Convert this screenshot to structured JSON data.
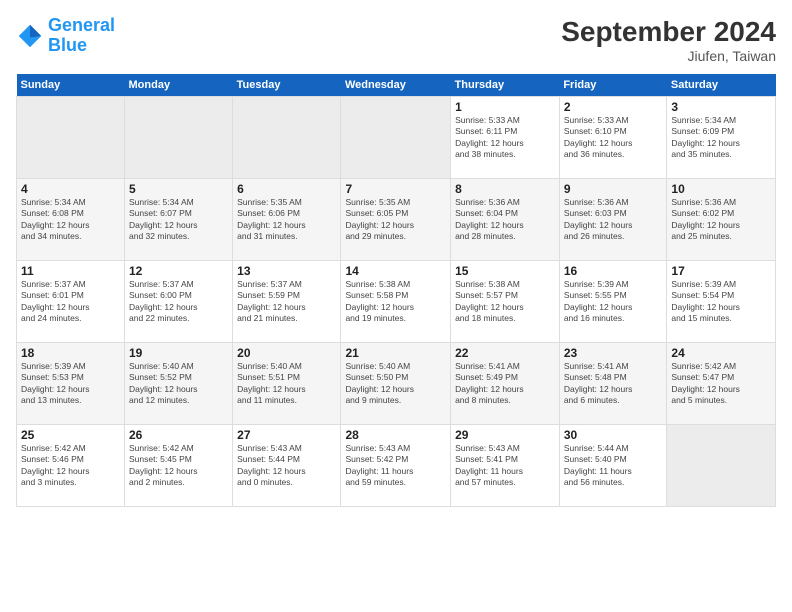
{
  "header": {
    "logo_line1": "General",
    "logo_line2": "Blue",
    "month": "September 2024",
    "location": "Jiufen, Taiwan"
  },
  "weekdays": [
    "Sunday",
    "Monday",
    "Tuesday",
    "Wednesday",
    "Thursday",
    "Friday",
    "Saturday"
  ],
  "days": [
    {
      "num": "",
      "info": "",
      "empty": true
    },
    {
      "num": "",
      "info": "",
      "empty": true
    },
    {
      "num": "",
      "info": "",
      "empty": true
    },
    {
      "num": "",
      "info": "",
      "empty": true
    },
    {
      "num": "1",
      "info": "Sunrise: 5:33 AM\nSunset: 6:11 PM\nDaylight: 12 hours\nand 38 minutes."
    },
    {
      "num": "2",
      "info": "Sunrise: 5:33 AM\nSunset: 6:10 PM\nDaylight: 12 hours\nand 36 minutes."
    },
    {
      "num": "3",
      "info": "Sunrise: 5:34 AM\nSunset: 6:09 PM\nDaylight: 12 hours\nand 35 minutes."
    },
    {
      "num": "4",
      "info": "Sunrise: 5:34 AM\nSunset: 6:08 PM\nDaylight: 12 hours\nand 34 minutes."
    },
    {
      "num": "5",
      "info": "Sunrise: 5:34 AM\nSunset: 6:07 PM\nDaylight: 12 hours\nand 32 minutes."
    },
    {
      "num": "6",
      "info": "Sunrise: 5:35 AM\nSunset: 6:06 PM\nDaylight: 12 hours\nand 31 minutes."
    },
    {
      "num": "7",
      "info": "Sunrise: 5:35 AM\nSunset: 6:05 PM\nDaylight: 12 hours\nand 29 minutes."
    },
    {
      "num": "8",
      "info": "Sunrise: 5:36 AM\nSunset: 6:04 PM\nDaylight: 12 hours\nand 28 minutes."
    },
    {
      "num": "9",
      "info": "Sunrise: 5:36 AM\nSunset: 6:03 PM\nDaylight: 12 hours\nand 26 minutes."
    },
    {
      "num": "10",
      "info": "Sunrise: 5:36 AM\nSunset: 6:02 PM\nDaylight: 12 hours\nand 25 minutes."
    },
    {
      "num": "11",
      "info": "Sunrise: 5:37 AM\nSunset: 6:01 PM\nDaylight: 12 hours\nand 24 minutes."
    },
    {
      "num": "12",
      "info": "Sunrise: 5:37 AM\nSunset: 6:00 PM\nDaylight: 12 hours\nand 22 minutes."
    },
    {
      "num": "13",
      "info": "Sunrise: 5:37 AM\nSunset: 5:59 PM\nDaylight: 12 hours\nand 21 minutes."
    },
    {
      "num": "14",
      "info": "Sunrise: 5:38 AM\nSunset: 5:58 PM\nDaylight: 12 hours\nand 19 minutes."
    },
    {
      "num": "15",
      "info": "Sunrise: 5:38 AM\nSunset: 5:57 PM\nDaylight: 12 hours\nand 18 minutes."
    },
    {
      "num": "16",
      "info": "Sunrise: 5:39 AM\nSunset: 5:55 PM\nDaylight: 12 hours\nand 16 minutes."
    },
    {
      "num": "17",
      "info": "Sunrise: 5:39 AM\nSunset: 5:54 PM\nDaylight: 12 hours\nand 15 minutes."
    },
    {
      "num": "18",
      "info": "Sunrise: 5:39 AM\nSunset: 5:53 PM\nDaylight: 12 hours\nand 13 minutes."
    },
    {
      "num": "19",
      "info": "Sunrise: 5:40 AM\nSunset: 5:52 PM\nDaylight: 12 hours\nand 12 minutes."
    },
    {
      "num": "20",
      "info": "Sunrise: 5:40 AM\nSunset: 5:51 PM\nDaylight: 12 hours\nand 11 minutes."
    },
    {
      "num": "21",
      "info": "Sunrise: 5:40 AM\nSunset: 5:50 PM\nDaylight: 12 hours\nand 9 minutes."
    },
    {
      "num": "22",
      "info": "Sunrise: 5:41 AM\nSunset: 5:49 PM\nDaylight: 12 hours\nand 8 minutes."
    },
    {
      "num": "23",
      "info": "Sunrise: 5:41 AM\nSunset: 5:48 PM\nDaylight: 12 hours\nand 6 minutes."
    },
    {
      "num": "24",
      "info": "Sunrise: 5:42 AM\nSunset: 5:47 PM\nDaylight: 12 hours\nand 5 minutes."
    },
    {
      "num": "25",
      "info": "Sunrise: 5:42 AM\nSunset: 5:46 PM\nDaylight: 12 hours\nand 3 minutes."
    },
    {
      "num": "26",
      "info": "Sunrise: 5:42 AM\nSunset: 5:45 PM\nDaylight: 12 hours\nand 2 minutes."
    },
    {
      "num": "27",
      "info": "Sunrise: 5:43 AM\nSunset: 5:44 PM\nDaylight: 12 hours\nand 0 minutes."
    },
    {
      "num": "28",
      "info": "Sunrise: 5:43 AM\nSunset: 5:42 PM\nDaylight: 11 hours\nand 59 minutes."
    },
    {
      "num": "29",
      "info": "Sunrise: 5:43 AM\nSunset: 5:41 PM\nDaylight: 11 hours\nand 57 minutes."
    },
    {
      "num": "30",
      "info": "Sunrise: 5:44 AM\nSunset: 5:40 PM\nDaylight: 11 hours\nand 56 minutes."
    },
    {
      "num": "",
      "info": "",
      "empty": true
    },
    {
      "num": "",
      "info": "",
      "empty": true
    },
    {
      "num": "",
      "info": "",
      "empty": true
    },
    {
      "num": "",
      "info": "",
      "empty": true
    },
    {
      "num": "",
      "info": "",
      "empty": true
    }
  ]
}
